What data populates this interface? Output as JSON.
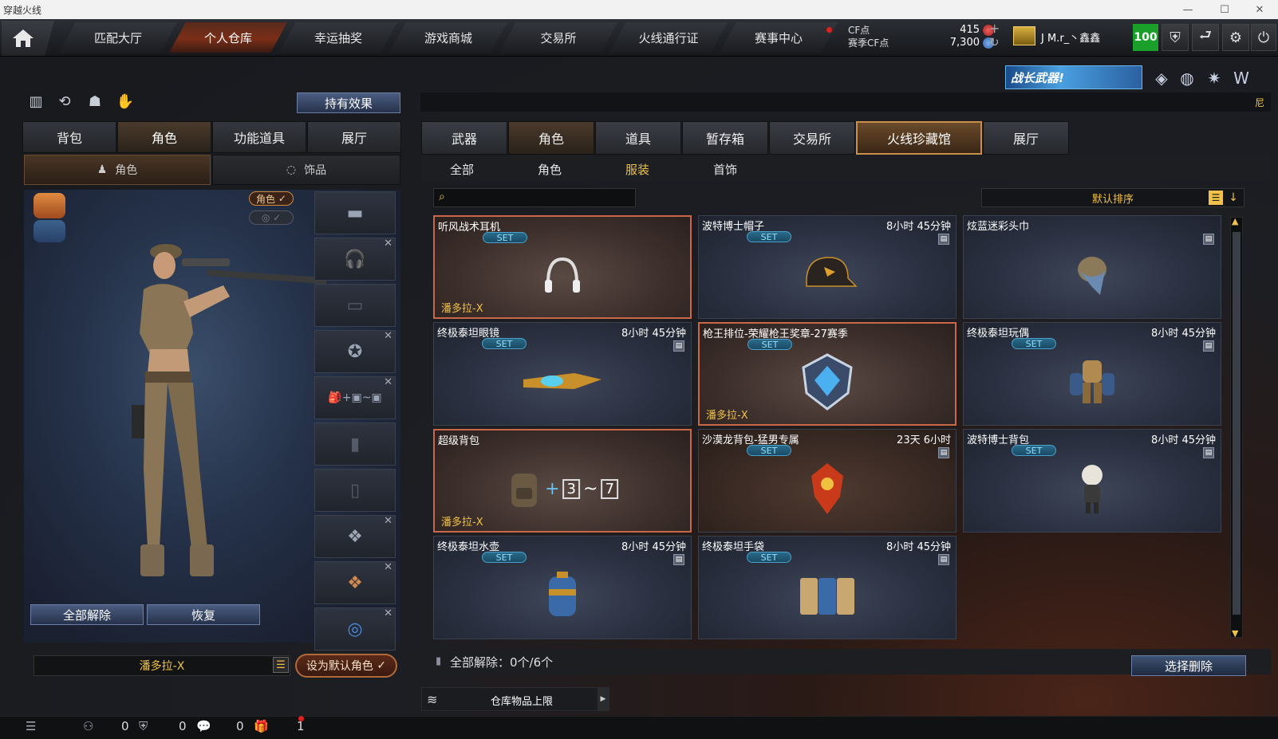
{
  "window": {
    "title": "穿越火线",
    "minimize": "—",
    "maximize": "☐",
    "close": "✕"
  },
  "nav": {
    "tabs": [
      "匹配大厅",
      "个人仓库",
      "幸运抽奖",
      "游戏商城",
      "交易所",
      "火线通行证",
      "赛事中心"
    ],
    "active": "个人仓库",
    "cf_label": "CF点",
    "season_cf_label": "赛季CF点",
    "cf_value": "415",
    "season_cf_value": "7,300",
    "plus": "+",
    "refresh": "↻",
    "username": "J M.r_丶鑫鑫",
    "level": "100"
  },
  "promo": {
    "text": "战长武器!"
  },
  "marquee": {
    "text": "尼"
  },
  "left": {
    "hold_effect": "持有效果",
    "tabs": [
      "背包",
      "角色",
      "功能道具",
      "展厅"
    ],
    "active_tab": "角色",
    "subtabs": [
      "角色",
      "饰品"
    ],
    "role_badge": "角色",
    "unequip_all": "全部解除",
    "restore": "恢复",
    "character_name": "潘多拉-X",
    "set_default": "设为默认角色"
  },
  "right": {
    "tabs": [
      "武器",
      "角色",
      "道具",
      "暂存箱",
      "交易所",
      "火线珍藏馆",
      "展厅"
    ],
    "active_tab": "角色",
    "subtabs": [
      "全部",
      "角色",
      "服装",
      "首饰"
    ],
    "active_subtab": "服装",
    "search_placeholder": "",
    "sort_label": "默认排序",
    "set_tag": "SET",
    "items": [
      {
        "name": "听风战术耳机",
        "time": "",
        "owner": "潘多拉-X",
        "equipped": true,
        "icon": "headphones-icon"
      },
      {
        "name": "波特博士帽子",
        "time": "8小时 45分钟",
        "owner": "",
        "equipped": false,
        "icon": "cap-icon"
      },
      {
        "name": "炫蓝迷彩头巾",
        "time": "",
        "owner": "",
        "equipped": false,
        "icon": "bandana-icon"
      },
      {
        "name": "终极泰坦眼镜",
        "time": "8小时 45分钟",
        "owner": "",
        "equipped": false,
        "icon": "goggles-icon"
      },
      {
        "name": "枪王排位-荣耀枪王奖章-27赛季",
        "time": "",
        "owner": "潘多拉-X",
        "equipped": true,
        "icon": "medal-icon"
      },
      {
        "name": "终极泰坦玩偶",
        "time": "8小时 45分钟",
        "owner": "",
        "equipped": false,
        "icon": "titan-doll-icon"
      },
      {
        "name": "超级背包",
        "time": "",
        "owner": "潘多拉-X",
        "equipped": true,
        "icon": "backpack-icon"
      },
      {
        "name": "沙漠龙背包-猛男专属",
        "time": "23天 6小时",
        "owner": "",
        "equipped": false,
        "icon": "dragon-backpack-icon"
      },
      {
        "name": "波特博士背包",
        "time": "8小时 45分钟",
        "owner": "",
        "equipped": false,
        "icon": "doll-backpack-icon"
      },
      {
        "name": "终极泰坦水壶",
        "time": "8小时 45分钟",
        "owner": "",
        "equipped": false,
        "icon": "canteen-icon"
      },
      {
        "name": "终极泰坦手袋",
        "time": "8小时 45分钟",
        "owner": "",
        "equipped": false,
        "icon": "pouch-icon"
      }
    ],
    "unequip_status": "全部解除：0个/6个",
    "select_delete": "选择删除",
    "storage_limit": "仓库物品上限"
  },
  "footer": {
    "count1": "0",
    "count2": "0",
    "count3": "0",
    "count4": "1"
  }
}
